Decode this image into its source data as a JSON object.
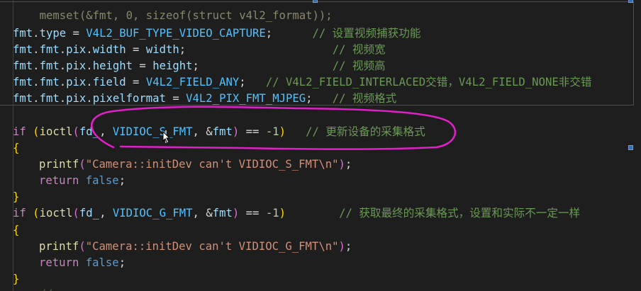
{
  "editor": {
    "top_partial": "memset(&fmt, 0, sizeof(struct v4l2_format));",
    "lines": {
      "type": {
        "a": "fmt",
        "b": ".",
        "c": "type",
        "d": " = ",
        "e": "V4L2_BUF_TYPE_VIDEO_CAPTURE",
        "f": ";",
        "pad": "      ",
        "g": "// 设置视频捕获功能"
      },
      "width": {
        "a": "fmt",
        "b": ".",
        "c": "fmt",
        "d": ".",
        "e": "pix",
        "f": ".",
        "g": "width",
        "h": " = ",
        "i": "width",
        "j": ";",
        "pad": "                      ",
        "k": "// 视频宽"
      },
      "height": {
        "a": "fmt",
        "b": ".",
        "c": "fmt",
        "d": ".",
        "e": "pix",
        "f": ".",
        "g": "height",
        "h": " = ",
        "i": "height",
        "j": ";",
        "pad": "                    ",
        "k": "// 视频高"
      },
      "field": {
        "a": "fmt",
        "b": ".",
        "c": "fmt",
        "d": ".",
        "e": "pix",
        "f": ".",
        "g": "field",
        "h": " = ",
        "i": "V4L2_FIELD_ANY",
        "j": ";",
        "pad": "   ",
        "k": "// V4L2_FIELD_INTERLACED交错，V4L2_FIELD_NONE非交错"
      },
      "pixfmt": {
        "a": "fmt",
        "b": ".",
        "c": "fmt",
        "d": ".",
        "e": "pix",
        "f": ".",
        "g": "pixelformat",
        "h": " = ",
        "i": "V4L2_PIX_FMT_MJPEG",
        "j": ";",
        "pad": "   ",
        "k": "// 视频格式"
      },
      "if1": {
        "a": "if",
        "b": " ",
        "c": "(",
        "d": "ioctl",
        "e": "(",
        "f": "fd_",
        "g": ", ",
        "h": "VIDIOC_S_FMT",
        "i": ", ",
        "j": "&",
        "k": "fmt",
        "l": ")",
        "m": " == ",
        "n": "-1",
        "o": ")",
        "pad": "   ",
        "p": "// 更新设备的采集格式"
      },
      "open1": "{",
      "printf1": {
        "a": "printf",
        "b": "(",
        "c": "\"Camera::initDev can't VIDIOC_S_FMT\\n\"",
        "d": ")",
        "e": ";"
      },
      "ret1": {
        "a": "return",
        "b": " ",
        "c": "false",
        "d": ";"
      },
      "close1": "}",
      "if2": {
        "a": "if",
        "b": " ",
        "c": "(",
        "d": "ioctl",
        "e": "(",
        "f": "fd_",
        "g": ", ",
        "h": "VIDIOC_G_FMT",
        "i": ", ",
        "j": "&",
        "k": "fmt",
        "l": ")",
        "m": " == ",
        "n": "-1",
        "o": ")",
        "pad": "        ",
        "p": "// 获取最终的采集格式，设置和实际不一定一样"
      },
      "open2": "{",
      "printf2": {
        "a": "printf",
        "b": "(",
        "c": "\"Camera::initDev can't VIDIOC_G_FMT\\n\"",
        "d": ")",
        "e": ";"
      },
      "ret2": {
        "a": "return",
        "b": " ",
        "c": "false",
        "d": ";"
      },
      "close2": "}",
      "bottom_partial": "    // ................................"
    }
  },
  "colors": {
    "annotation_stroke": "#e020c8",
    "background": "#1e1e1e"
  }
}
